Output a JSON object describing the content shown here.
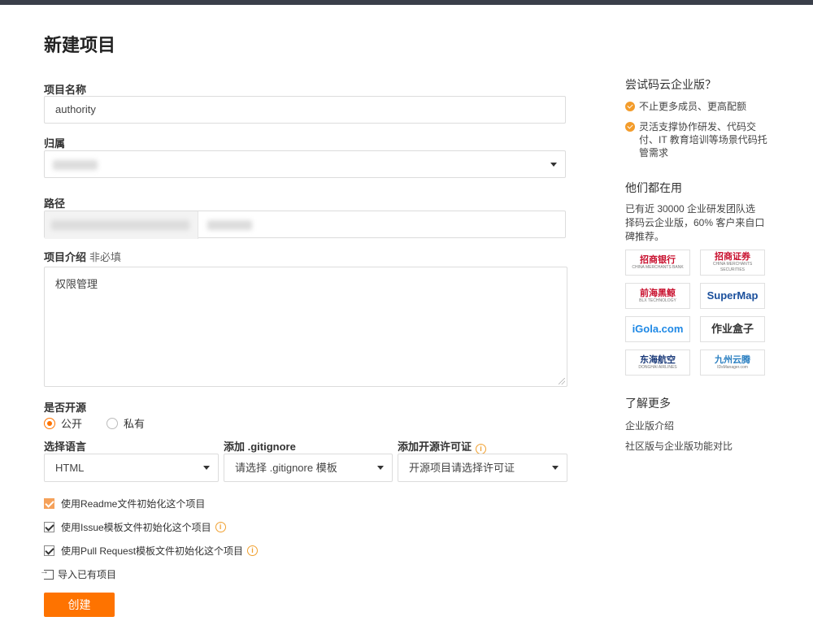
{
  "page": {
    "title": "新建项目"
  },
  "form": {
    "name_label": "项目名称",
    "name_value": "authority",
    "owner_label": "归属",
    "path_label": "路径",
    "desc_label": "项目介绍",
    "desc_optional": "非必填",
    "desc_value": "权限管理",
    "open_source_label": "是否开源",
    "visibility_options": [
      {
        "label": "公开",
        "selected": true
      },
      {
        "label": "私有",
        "selected": false
      }
    ],
    "language_label": "选择语言",
    "language_value": "HTML",
    "gitignore_label": "添加 .gitignore",
    "gitignore_value": "请选择 .gitignore 模板",
    "license_label": "添加开源许可证",
    "license_value": "开源项目请选择许可证",
    "checkboxes": [
      {
        "label": "使用Readme文件初始化这个项目",
        "checked": true,
        "info": false
      },
      {
        "label": "使用Issue模板文件初始化这个项目",
        "checked": true,
        "info": true
      },
      {
        "label": "使用Pull Request模板文件初始化这个项目",
        "checked": true,
        "info": true
      }
    ],
    "import_label": "导入已有项目",
    "submit_label": "创建"
  },
  "sidebar": {
    "try_title": "尝试码云企业版？",
    "bullets": [
      "不止更多成员、更高配额",
      "灵活支撑协作研发、代码交付、IT 教育培训等场景代码托管需求"
    ],
    "users_title": "他们都在用",
    "users_text": "已有近 30000 企业研发团队选择码云企业版，60% 客户来自口碑推荐。",
    "logos": [
      {
        "name": "招商银行",
        "sub": "CHINA MERCHANTS BANK",
        "color": "#c8102e"
      },
      {
        "name": "招商证券",
        "sub": "CHINA MERCHANTS SECURITIES",
        "color": "#c8102e"
      },
      {
        "name": "前海黑鲸",
        "sub": "BLX TECHNOLOGY",
        "color": "#c8102e"
      },
      {
        "name": "SuperMap",
        "sub": "",
        "color": "#1a4f9c"
      },
      {
        "name": "iGola.com",
        "sub": "",
        "color": "#1e88e5"
      },
      {
        "name": "作业盒子",
        "sub": "",
        "color": "#333333"
      },
      {
        "name": "东海航空",
        "sub": "DONGHAI AIRLINES",
        "color": "#1a3a7a"
      },
      {
        "name": "九州云腾",
        "sub": "IDsManager.com",
        "color": "#2a7fc1"
      }
    ],
    "more_title": "了解更多",
    "links": [
      "企业版介绍",
      "社区版与企业版功能对比"
    ]
  },
  "colors": {
    "accent": "#fe7300",
    "check": "#f39c2b",
    "border": "#dcdcdc"
  }
}
